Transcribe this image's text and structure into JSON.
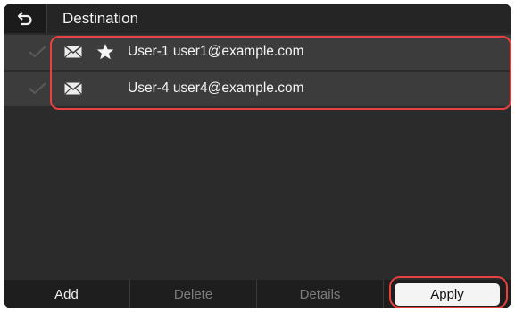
{
  "header": {
    "title": "Destination",
    "back_icon": "back-arrow-icon"
  },
  "destinations": [
    {
      "name": "User-1 user1@example.com",
      "favorite": true,
      "selected": true
    },
    {
      "name": "User-4 user4@example.com",
      "favorite": false,
      "selected": true
    }
  ],
  "toolbar": {
    "add_label": "Add",
    "delete_label": "Delete",
    "details_label": "Details",
    "apply_label": "Apply"
  },
  "colors": {
    "highlight": "#e8413f",
    "background": "#2b2b2b",
    "row": "#3c3c3c"
  }
}
